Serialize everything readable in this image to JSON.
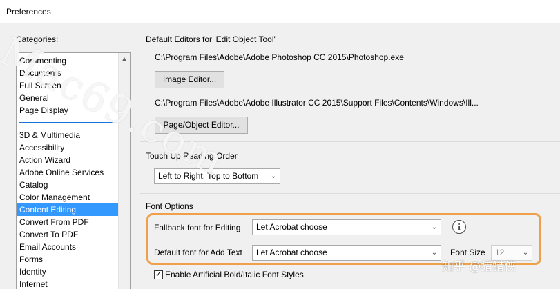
{
  "window": {
    "title": "Preferences"
  },
  "categories": {
    "label": "Categories:",
    "group1": [
      "Commenting",
      "Documents",
      "Full Screen",
      "General",
      "Page Display"
    ],
    "group2": [
      "3D & Multimedia",
      "Accessibility",
      "Action Wizard",
      "Adobe Online Services",
      "Catalog",
      "Color Management",
      "Content Editing",
      "Convert From PDF",
      "Convert To PDF",
      "Email Accounts",
      "Forms",
      "Identity",
      "Internet"
    ],
    "selected": "Content Editing"
  },
  "editors": {
    "section_title": "Default Editors for 'Edit Object Tool'",
    "image_path": "C:\\Program Files\\Adobe\\Adobe Photoshop CC 2015\\Photoshop.exe",
    "image_button": "Image Editor...",
    "page_path": "C:\\Program Files\\Adobe\\Adobe Illustrator CC 2015\\Support Files\\Contents\\Windows\\Ill...",
    "page_button": "Page/Object Editor..."
  },
  "touchup": {
    "section_title": "Touch Up Reading Order",
    "order_value": "Left to Right, Top to Bottom"
  },
  "font_options": {
    "section_title": "Font Options",
    "fallback_label": "Fallback font for Editing",
    "fallback_value": "Let Acrobat choose",
    "default_label": "Default font for Add Text",
    "default_value": "Let Acrobat choose",
    "size_label": "Font Size",
    "size_value": "12",
    "bold_italic_label": "Enable Artificial Bold/Italic Font Styles",
    "bold_italic_checked": true
  },
  "icons": {
    "info": "info-icon",
    "dropdown": "chevron-down-icon",
    "scroll_up": "scroll-up-icon"
  },
  "colors": {
    "selection": "#3399ff",
    "highlight": "#f0a04b",
    "separator": "#1a73d9"
  },
  "watermarks": {
    "site": "Mac69.com",
    "author": "知乎 @猎猎侠"
  }
}
